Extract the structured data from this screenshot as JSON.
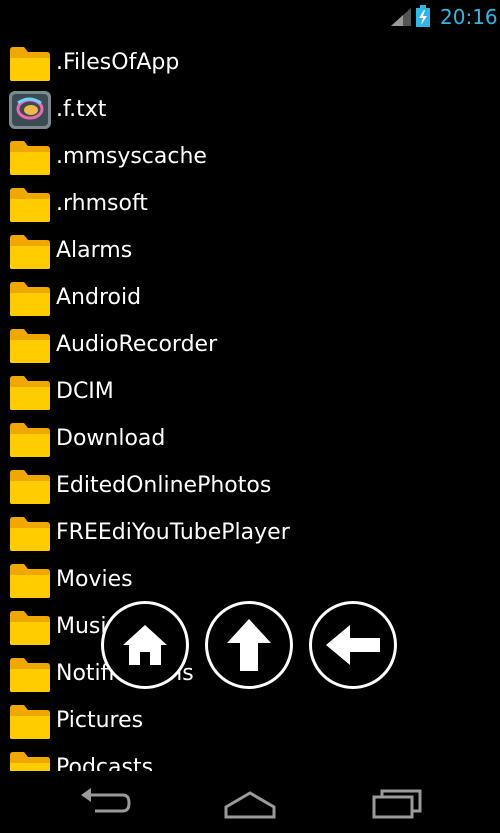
{
  "status_bar": {
    "time": "20:16",
    "clock_color": "#33b5e5"
  },
  "files": [
    {
      "name": ".FilesOfApp",
      "icon": "folder-icon"
    },
    {
      "name": ".f.txt",
      "icon": "app-file-icon"
    },
    {
      "name": ".mmsyscache",
      "icon": "folder-icon"
    },
    {
      "name": ".rhmsoft",
      "icon": "folder-icon"
    },
    {
      "name": "Alarms",
      "icon": "folder-icon"
    },
    {
      "name": "Android",
      "icon": "folder-icon"
    },
    {
      "name": "AudioRecorder",
      "icon": "folder-icon"
    },
    {
      "name": "DCIM",
      "icon": "folder-icon"
    },
    {
      "name": "Download",
      "icon": "folder-icon"
    },
    {
      "name": "EditedOnlinePhotos",
      "icon": "folder-icon"
    },
    {
      "name": "FREEdiYouTubePlayer",
      "icon": "folder-icon"
    },
    {
      "name": "Movies",
      "icon": "folder-icon"
    },
    {
      "name": "Music",
      "icon": "folder-icon"
    },
    {
      "name": "Notifications",
      "icon": "folder-icon"
    },
    {
      "name": "Pictures",
      "icon": "folder-icon"
    },
    {
      "name": "Podcasts",
      "icon": "folder-icon"
    }
  ],
  "actions": {
    "home": "home-icon",
    "up": "arrow-up-icon",
    "back": "arrow-left-icon"
  },
  "nav_bar": {
    "back": "nav-back-icon",
    "home": "nav-home-icon",
    "recents": "nav-recents-icon"
  },
  "colors": {
    "folder": "#ffcc00",
    "folder_dark": "#f0a800",
    "background": "#000000",
    "text": "#ffffff",
    "nav_icon": "#9a9a9a"
  }
}
